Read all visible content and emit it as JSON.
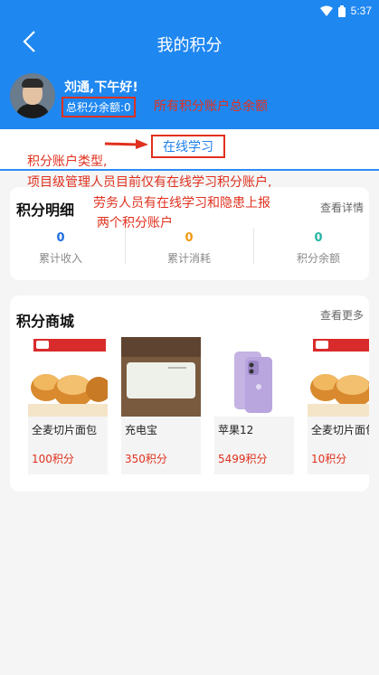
{
  "status_bar": {
    "time": "5:37"
  },
  "header": {
    "title": "我的积分"
  },
  "user": {
    "greeting": "刘通,下午好!",
    "total_balance": "总积分余额:0"
  },
  "tabs": [
    {
      "label": "在线学习"
    }
  ],
  "annotations": {
    "total_note": "所有积分账户总余额",
    "type_note": "积分账户类型,",
    "line2": "项目级管理人员目前仅有在线学习积分账户,",
    "line3": "劳务人员有在线学习和隐患上报",
    "line4": "两个积分账户",
    "color": "#e0301e"
  },
  "details": {
    "title": "积分明细",
    "link": "查看详情",
    "stats": [
      {
        "value": "0",
        "label": "累计收入",
        "color": "#1f6fe0"
      },
      {
        "value": "0",
        "label": "累计消耗",
        "color": "#f29a11"
      },
      {
        "value": "0",
        "label": "积分余额",
        "color": "#26b5a2"
      }
    ]
  },
  "mall": {
    "title": "积分商城",
    "link": "查看更多",
    "products": [
      {
        "name": "全麦切片面包",
        "price": "100积分",
        "image": "bread-image"
      },
      {
        "name": "充电宝",
        "price": "350积分",
        "image": "power-bank-image"
      },
      {
        "name": "苹果12",
        "price": "5499积分",
        "image": "iphone-image"
      },
      {
        "name": "全麦切片面包",
        "price": "10积分",
        "image": "bread-image"
      }
    ]
  },
  "colors": {
    "primary": "#1f87f0",
    "accent_red": "#e0301e"
  }
}
